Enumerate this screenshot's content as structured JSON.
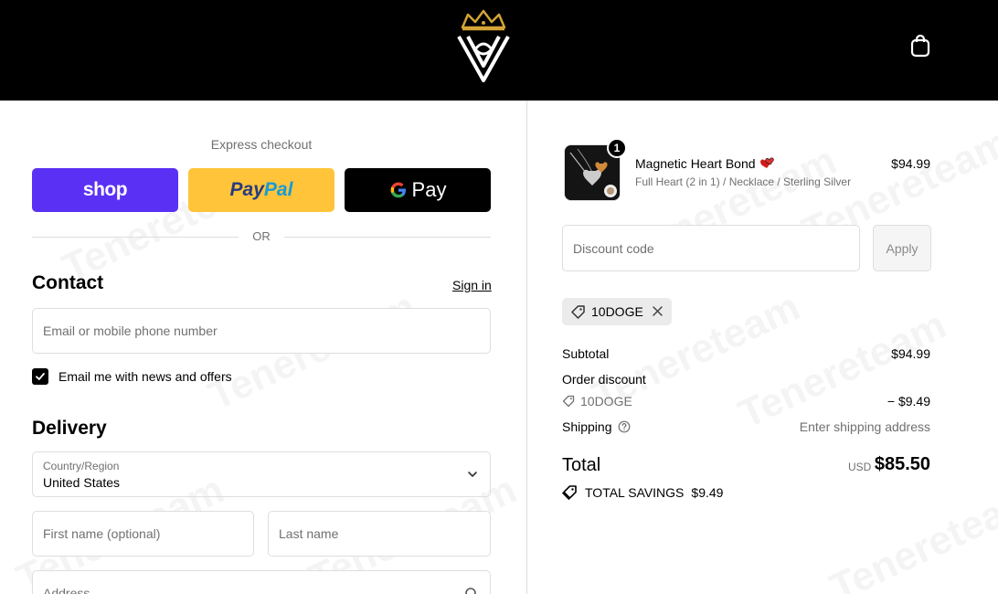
{
  "header": {
    "logo_alt": "Store logo",
    "cart_icon": "shopping-bag-icon"
  },
  "watermark": "Tenereteam",
  "express": {
    "title": "Express checkout",
    "shop_label": "shop",
    "paypal_pay": "Pay",
    "paypal_pal": "Pal",
    "gpay_g": "G",
    "gpay_label": "Pay",
    "or_label": "OR"
  },
  "contact": {
    "title": "Contact",
    "sign_in": "Sign in",
    "email_placeholder": "Email or mobile phone number",
    "newsletter_label": "Email me with news and offers",
    "newsletter_checked": true
  },
  "delivery": {
    "title": "Delivery",
    "country_label": "Country/Region",
    "country_value": "United States",
    "first_name_placeholder": "First name (optional)",
    "last_name_placeholder": "Last name",
    "address_placeholder": "Address"
  },
  "order": {
    "item": {
      "name": "Magnetic Heart Bond",
      "variant": "Full Heart (2 in 1) / Necklace / Sterling Silver",
      "price": "$94.99",
      "quantity": "1"
    },
    "discount_placeholder": "Discount code",
    "apply_label": "Apply",
    "applied_code": "10DOGE",
    "subtotal_label": "Subtotal",
    "subtotal_value": "$94.99",
    "order_discount_label": "Order discount",
    "order_discount_code": "10DOGE",
    "order_discount_value": "− $9.49",
    "shipping_label": "Shipping",
    "shipping_value": "Enter shipping address",
    "total_label": "Total",
    "total_currency": "USD",
    "total_value": "$85.50",
    "savings_label": "TOTAL SAVINGS",
    "savings_value": "$9.49"
  },
  "colors": {
    "shop_purple": "#5a31f4",
    "paypal_yellow": "#ffc439",
    "logo_gold": "#d4a437"
  }
}
